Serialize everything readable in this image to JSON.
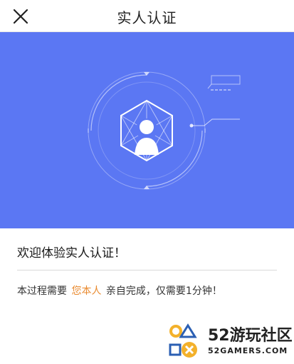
{
  "header": {
    "title": "实人认证",
    "close_icon": "close-icon"
  },
  "hero": {
    "background": "#5b77f3",
    "illustration": "face-verification-illustration"
  },
  "content": {
    "welcome": "欢迎体验实人认证！",
    "instruction_before": "本过程需要",
    "instruction_highlight": "您本人",
    "instruction_after": "亲自完成，仅需要1分钟！",
    "highlight_color": "#e98a2f"
  },
  "watermark": {
    "brand": "52游玩社区",
    "domain": "52GAMERS.COM"
  }
}
